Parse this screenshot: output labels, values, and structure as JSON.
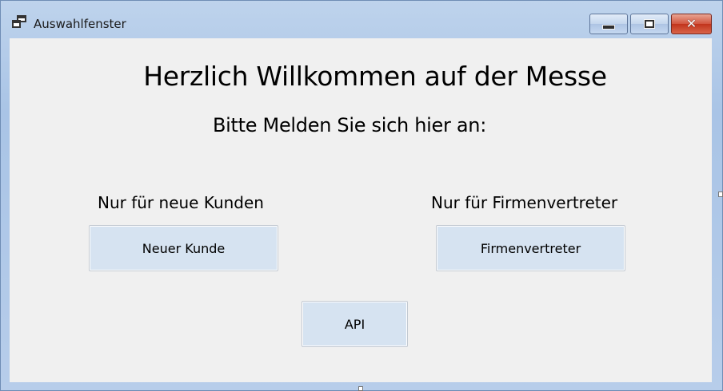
{
  "window": {
    "title": "Auswahlfenster",
    "icon": "app-window-icon",
    "controls": {
      "minimize_icon": "minimize-icon",
      "maximize_icon": "maximize-icon",
      "close_glyph": "✕"
    },
    "accent_color": "#c2341c"
  },
  "main": {
    "heading": "Herzlich Willkommen auf der Messe",
    "subheading": "Bitte Melden Sie sich hier an:",
    "left_label": "Nur für neue Kunden",
    "right_label": "Nur für Firmenvertreter",
    "buttons": {
      "new_customer": "Neuer Kunde",
      "representative": "Firmenvertreter",
      "api": "API"
    }
  }
}
